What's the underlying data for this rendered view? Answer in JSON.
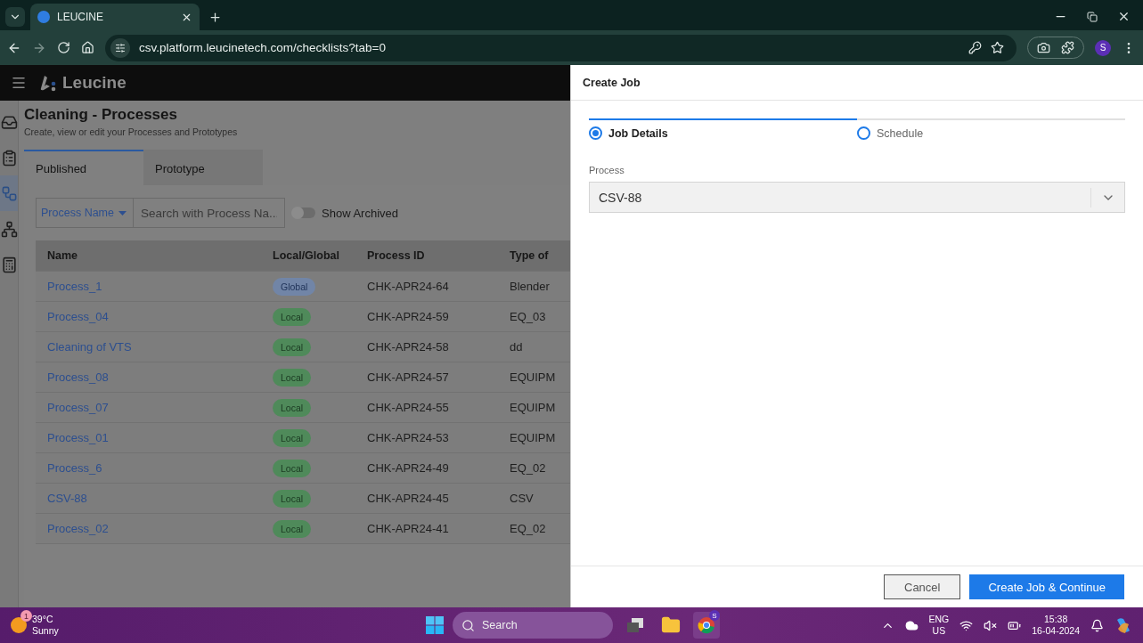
{
  "browser": {
    "tab_title": "LEUCINE",
    "url": "csv.platform.leucinetech.com/checklists?tab=0",
    "profile_initial": "S"
  },
  "app": {
    "logo": "Leucine",
    "sidebar": [
      {
        "selected": false
      },
      {
        "selected": false
      },
      {
        "selected": true
      },
      {
        "selected": false
      },
      {
        "selected": false
      }
    ],
    "page_title": "Cleaning - Processes",
    "page_subtitle": "Create, view or edit your Processes and Prototypes",
    "tabs": [
      {
        "label": "Published",
        "selected": true
      },
      {
        "label": "Prototype",
        "selected": false
      }
    ],
    "filter": {
      "dropdown": "Process Name",
      "placeholder": "Search with Process Na...",
      "toggle": {
        "label": "Show Archived",
        "on": false
      }
    },
    "table": {
      "columns": [
        "Name",
        "Local/Global",
        "Process ID",
        "Type of"
      ],
      "rows": [
        {
          "name": "Process_1",
          "scope": "Global",
          "kind": "global",
          "process_id": "CHK-APR24-64",
          "type": "Blender"
        },
        {
          "name": "Process_04",
          "scope": "Local",
          "kind": "local",
          "process_id": "CHK-APR24-59",
          "type": "EQ_03"
        },
        {
          "name": "Cleaning of VTS",
          "scope": "Local",
          "kind": "local",
          "process_id": "CHK-APR24-58",
          "type": "dd"
        },
        {
          "name": "Process_08",
          "scope": "Local",
          "kind": "local",
          "process_id": "CHK-APR24-57",
          "type": "EQUIPM"
        },
        {
          "name": "Process_07",
          "scope": "Local",
          "kind": "local",
          "process_id": "CHK-APR24-55",
          "type": "EQUIPM"
        },
        {
          "name": "Process_01",
          "scope": "Local",
          "kind": "local",
          "process_id": "CHK-APR24-53",
          "type": "EQUIPM"
        },
        {
          "name": "Process_6",
          "scope": "Local",
          "kind": "local",
          "process_id": "CHK-APR24-49",
          "type": "EQ_02"
        },
        {
          "name": "CSV-88",
          "scope": "Local",
          "kind": "local",
          "process_id": "CHK-APR24-45",
          "type": "CSV"
        },
        {
          "name": "Process_02",
          "scope": "Local",
          "kind": "local",
          "process_id": "CHK-APR24-41",
          "type": "EQ_02"
        }
      ]
    }
  },
  "drawer": {
    "title": "Create Job",
    "steps": [
      {
        "label": "Job Details",
        "selected": true
      },
      {
        "label": "Schedule",
        "selected": false
      }
    ],
    "field": {
      "label": "Process",
      "value": "CSV-88"
    },
    "buttons": [
      {
        "label": "Cancel",
        "kind": "secondary"
      },
      {
        "label": "Create Job & Continue",
        "kind": "primary"
      }
    ]
  },
  "taskbar": {
    "weather": {
      "badge": "1",
      "temp": "39°C",
      "condition": "Sunny"
    },
    "search": "Search",
    "chrome_badge": "S",
    "language": "ENG",
    "region": "US",
    "time": "15:38",
    "date": "16-04-2024"
  }
}
